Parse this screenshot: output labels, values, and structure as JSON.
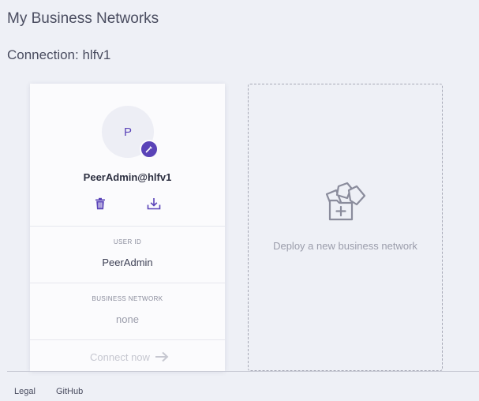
{
  "header": {
    "title": "My Business Networks"
  },
  "connection": {
    "title": "Connection: hlfv1"
  },
  "id_card": {
    "avatar_initial": "P",
    "name": "PeerAdmin@hlfv1",
    "user_id_label": "USER ID",
    "user_id": "PeerAdmin",
    "business_network_label": "BUSINESS NETWORK",
    "business_network": "none",
    "connect_label": "Connect now"
  },
  "deploy_card": {
    "label": "Deploy a new business network"
  },
  "footer": {
    "links": [
      "Legal",
      "GitHub"
    ]
  },
  "colors": {
    "accent": "#5a43b8",
    "background": "#eef0f6",
    "card": "#fbfbfd"
  },
  "icons": [
    "edit-icon",
    "trash-icon",
    "download-icon",
    "arrow-right-icon",
    "deploy-files-icon"
  ]
}
